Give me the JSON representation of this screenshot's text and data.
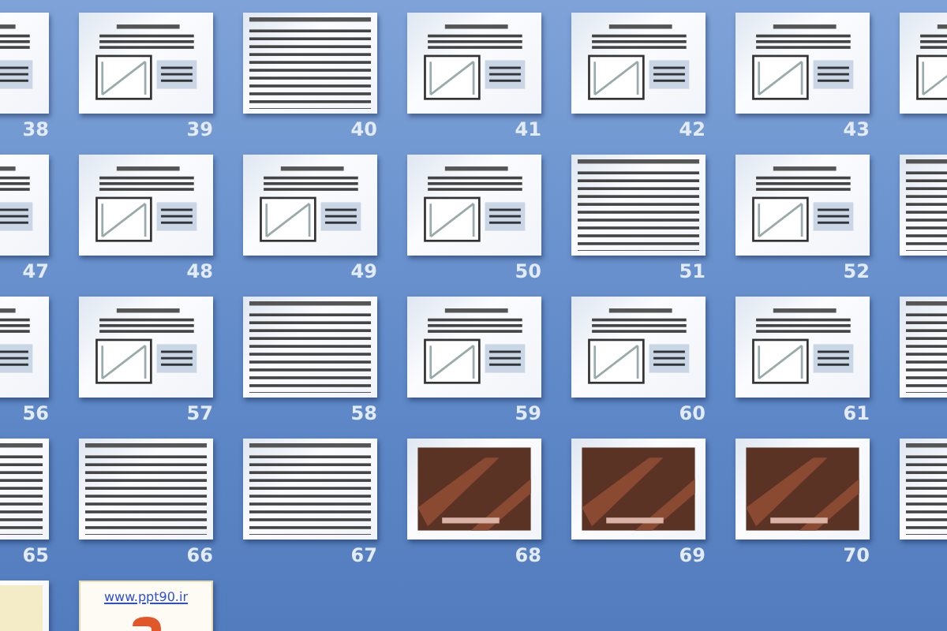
{
  "slide_rows": [
    [
      {
        "number": "38",
        "kind": "figure"
      },
      {
        "number": "39",
        "kind": "figure"
      },
      {
        "number": "40",
        "kind": "text"
      },
      {
        "number": "41",
        "kind": "figure"
      },
      {
        "number": "42",
        "kind": "figure"
      },
      {
        "number": "43",
        "kind": "figure"
      },
      {
        "kind": "figure"
      }
    ],
    [
      {
        "number": "47",
        "kind": "figure"
      },
      {
        "number": "48",
        "kind": "figure"
      },
      {
        "number": "49",
        "kind": "figure"
      },
      {
        "number": "50",
        "kind": "figure"
      },
      {
        "number": "51",
        "kind": "text"
      },
      {
        "number": "52",
        "kind": "figure"
      },
      {
        "kind": "text"
      }
    ],
    [
      {
        "number": "56",
        "kind": "figure"
      },
      {
        "number": "57",
        "kind": "figure"
      },
      {
        "number": "58",
        "kind": "text"
      },
      {
        "number": "59",
        "kind": "figure"
      },
      {
        "number": "60",
        "kind": "figure"
      },
      {
        "number": "61",
        "kind": "figure"
      },
      {
        "kind": "text"
      }
    ],
    [
      {
        "number": "65",
        "kind": "text"
      },
      {
        "number": "66",
        "kind": "text"
      },
      {
        "number": "67",
        "kind": "text"
      },
      {
        "number": "68",
        "kind": "photo"
      },
      {
        "number": "69",
        "kind": "photo"
      },
      {
        "number": "70",
        "kind": "photo"
      },
      {
        "kind": "text"
      }
    ],
    [
      {
        "kind": "cover"
      },
      {
        "kind": "link",
        "link": "www.ppt90.ir"
      }
    ]
  ]
}
